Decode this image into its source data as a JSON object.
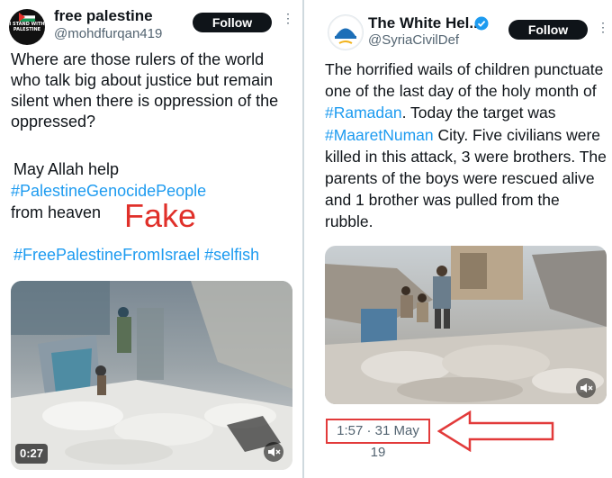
{
  "left_post": {
    "author_name": "free palestine",
    "handle": "@mohdfurqan419",
    "avatar_text": "I STAND WITH PALESTINE",
    "follow_label": "Follow",
    "more_label": "⋮",
    "paragraph1": "Where are those rulers of the world who talk big about justice but remain silent when there is oppression of the oppressed?",
    "line_may_allah": "May Allah help",
    "hashtag_genocide": "#PalestineGenocidePeople",
    "line_from_heaven": "from heaven",
    "fake_label": "Fake",
    "hashtags_line": "#FreePalestineFromIsrael #selfish",
    "video_duration": "0:27"
  },
  "right_post": {
    "author_name": "The White Hel...",
    "handle": "@SyriaCivilDef",
    "follow_label": "Follow",
    "more_label": "⋮",
    "body": {
      "part1": "The horrified wails of children punctuate one of the last day of the holy month of ",
      "tag1": "#Ramadan",
      "part2": ". Today the target was ",
      "tag2": "#MaaretNuman",
      "part3": " City. Five civilians were killed in this attack, 3 were brothers. The parents of the boys were rescued alive and 1 brother was pulled from the rubble."
    },
    "timestamp": "1:57 · 31 May 19"
  },
  "colors": {
    "hashtag": "#1d9bf0",
    "fake_text": "#e0302a",
    "annotation_red": "#e23a3a",
    "follow_bg": "#0f1419",
    "verified_blue": "#1d9bf0"
  },
  "icons": [
    "more-icon",
    "verified-badge-icon",
    "mute-icon",
    "annotation-arrow-icon"
  ]
}
